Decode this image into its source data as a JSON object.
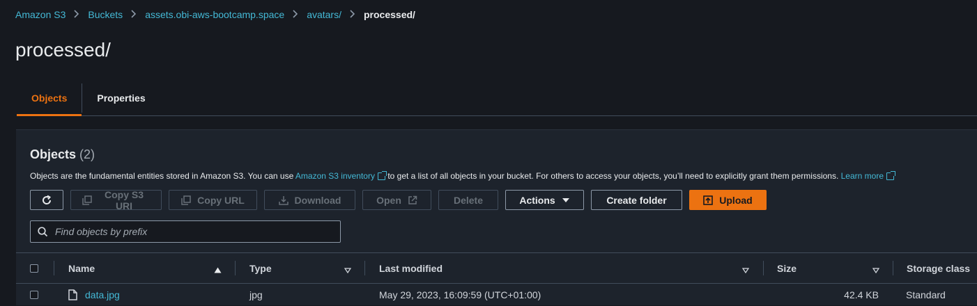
{
  "breadcrumb": {
    "items": [
      "Amazon S3",
      "Buckets",
      "assets.obi-aws-bootcamp.space",
      "avatars/"
    ],
    "current": "processed/"
  },
  "page": {
    "title": "processed/"
  },
  "tabs": [
    {
      "label": "Objects",
      "active": true
    },
    {
      "label": "Properties",
      "active": false
    }
  ],
  "objects_panel": {
    "title": "Objects",
    "count": "(2)",
    "description": {
      "before_link": "Objects are the fundamental entities stored in Amazon S3. You can use ",
      "link": "Amazon S3 inventory",
      "middle": " to get a list of all objects in your bucket. For others to access your objects, you’ll need to explicitly grant them permissions. ",
      "learn_more": "Learn more"
    }
  },
  "toolbar": {
    "copy_s3_uri": "Copy S3 URI",
    "copy_url": "Copy URL",
    "download": "Download",
    "open": "Open",
    "delete": "Delete",
    "actions": "Actions",
    "create_folder": "Create folder",
    "upload": "Upload"
  },
  "search": {
    "placeholder": "Find objects by prefix"
  },
  "table": {
    "columns": [
      "Name",
      "Type",
      "Last modified",
      "Size",
      "Storage class"
    ],
    "rows": [
      {
        "name": "data.jpg",
        "type": "jpg",
        "last_modified": "May 29, 2023, 16:09:59 (UTC+01:00)",
        "size": "42.4 KB",
        "storage_class": "Standard"
      }
    ]
  },
  "colors": {
    "link": "#44b9d6",
    "accent": "#ec7211",
    "background": "#16191f",
    "panel": "#1d232c"
  }
}
